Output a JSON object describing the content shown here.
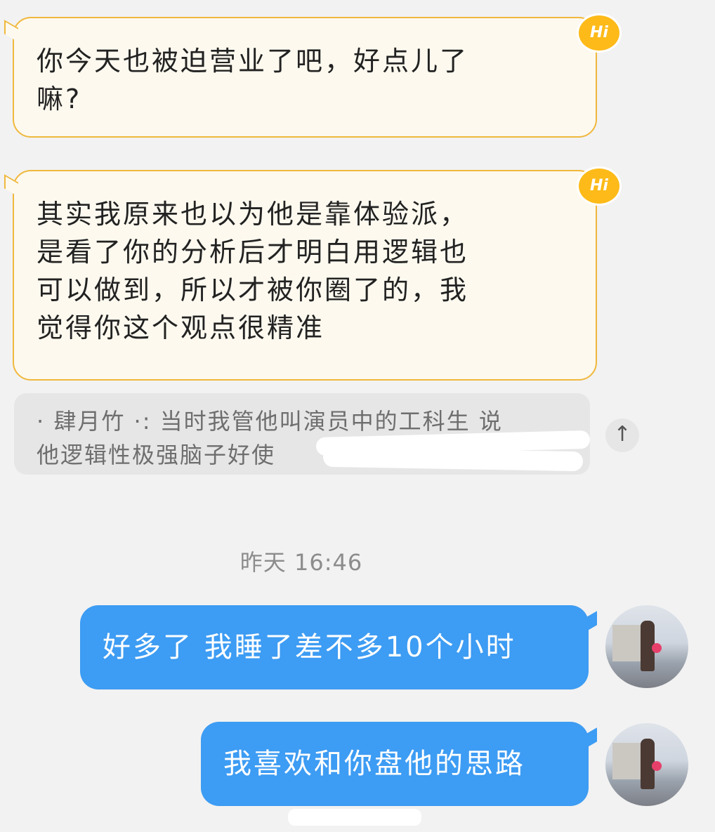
{
  "messages": [
    {
      "side": "in",
      "text_lines": [
        "你今天也被迫营业了吧，好点儿了",
        "嘛?"
      ],
      "badge": "Hi"
    },
    {
      "side": "in",
      "text_lines": [
        "其实我原来也以为他是靠体验派，",
        "是看了你的分析后才明白用逻辑也",
        "可以做到，所以才被你圈了的，我",
        "觉得你这个观点很精准"
      ],
      "badge": "Hi"
    }
  ],
  "quote": {
    "lines": [
      "· 肆月竹 ·: 当时我管他叫演员中的工科生 说",
      "他逻辑性极强脑子好使"
    ],
    "scroll_up_icon": "↑"
  },
  "timestamp": "昨天 16:46",
  "sent": [
    {
      "text": "好多了 我睡了差不多10个小时"
    },
    {
      "text": "我喜欢和你盘他的思路"
    }
  ],
  "colors": {
    "incoming_bg": "#fdf9ef",
    "incoming_border": "#f0b83c",
    "badge": "#fdba19",
    "outgoing_bg": "#3d9cf3",
    "background": "#f2f2f2"
  }
}
